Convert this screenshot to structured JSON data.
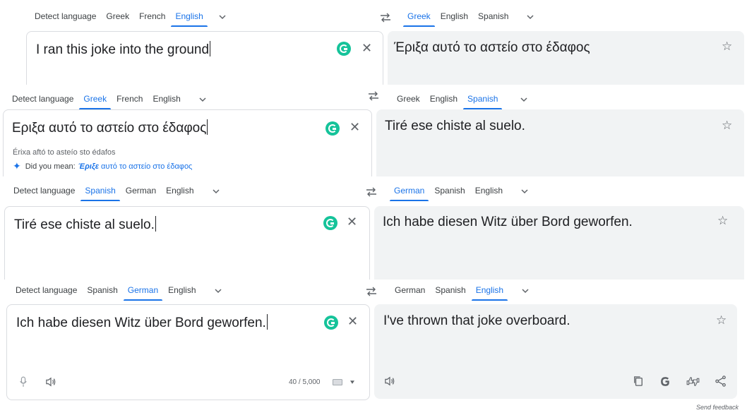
{
  "row1": {
    "src_tabs": [
      "Detect language",
      "Greek",
      "French",
      "English"
    ],
    "src_active": 3,
    "tgt_tabs": [
      "Greek",
      "English",
      "Spanish"
    ],
    "tgt_active": 0,
    "source_text": "I ran this joke into the ground",
    "target_text": "Έριξα αυτό το αστείο στο έδαφος"
  },
  "row2": {
    "src_tabs": [
      "Detect language",
      "Greek",
      "French",
      "English"
    ],
    "src_active": 1,
    "tgt_tabs": [
      "Greek",
      "English",
      "Spanish"
    ],
    "tgt_active": 2,
    "source_text": "Εριξα αυτό το αστείο στο έδαφος",
    "transliteration": "Érixa aftó to asteío sto édafos",
    "did_you_mean_label": "Did you mean:",
    "did_you_mean_highlight": "Έριξε",
    "did_you_mean_rest": "αυτό το αστείο στο έδαφος",
    "target_text": "Tiré ese chiste al suelo."
  },
  "row3": {
    "src_tabs": [
      "Detect language",
      "Spanish",
      "German",
      "English"
    ],
    "src_active": 1,
    "tgt_tabs": [
      "German",
      "Spanish",
      "English"
    ],
    "tgt_active": 0,
    "source_text": "Tiré ese chiste al suelo.",
    "target_text": "Ich habe diesen Witz über Bord geworfen."
  },
  "row4": {
    "src_tabs": [
      "Detect language",
      "Spanish",
      "German",
      "English"
    ],
    "src_active": 2,
    "tgt_tabs": [
      "German",
      "Spanish",
      "English"
    ],
    "tgt_active": 2,
    "source_text": "Ich habe diesen Witz über Bord geworfen.",
    "target_text": "I've thrown that joke overboard.",
    "char_count": "40 / 5,000"
  },
  "send_feedback": "Send feedback",
  "colors": {
    "accent": "#1a73e8",
    "grammarly": "#15c39a",
    "target_bg": "#f1f3f4"
  }
}
